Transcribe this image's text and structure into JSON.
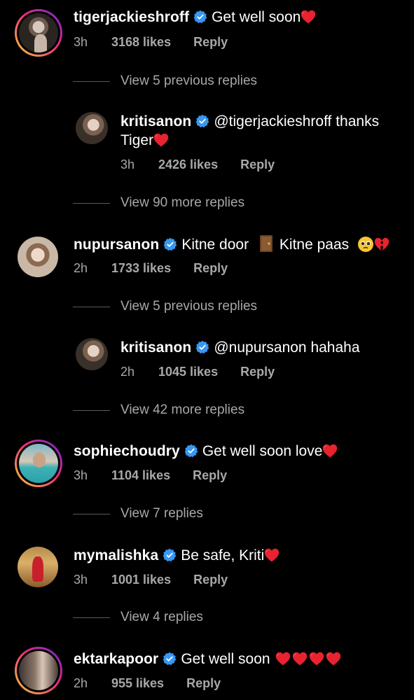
{
  "comments": [
    {
      "username": "tigerjackieshroff",
      "text": "Get well soon",
      "time": "3h",
      "likes": "3168 likes",
      "reply": "Reply",
      "view_replies": "View 5 previous replies",
      "replies": [
        {
          "username": "kritisanon",
          "text": "@tigerjackieshroff thanks Tiger",
          "time": "3h",
          "likes": "2426 likes",
          "reply": "Reply"
        }
      ],
      "view_more": "View 90 more replies"
    },
    {
      "username": "nupursanon",
      "text_a": "Kitne door",
      "text_b": "Kitne paas",
      "time": "2h",
      "likes": "1733 likes",
      "reply": "Reply",
      "view_replies": "View 5 previous replies",
      "replies": [
        {
          "username": "kritisanon",
          "text": "@nupursanon hahaha",
          "time": "2h",
          "likes": "1045 likes",
          "reply": "Reply"
        }
      ],
      "view_more": "View 42 more replies"
    },
    {
      "username": "sophiechoudry",
      "text": "Get well soon love",
      "time": "3h",
      "likes": "1104 likes",
      "reply": "Reply",
      "view_more": "View 7 replies"
    },
    {
      "username": "mymalishka",
      "text": "Be safe, Kriti",
      "time": "3h",
      "likes": "1001 likes",
      "reply": "Reply",
      "view_more": "View 4 replies"
    },
    {
      "username": "ektarkapoor",
      "text": "Get well soon",
      "time": "2h",
      "likes": "955 likes",
      "reply": "Reply"
    }
  ],
  "colors": {
    "background": "#000000",
    "verified": "#3897f0",
    "heart": "#e8232f",
    "meta": "#a8a8a8"
  },
  "icons": [
    "verified-badge-icon",
    "heart-icon",
    "door-emoji-icon",
    "pleading-face-emoji-icon",
    "broken-heart-icon"
  ]
}
